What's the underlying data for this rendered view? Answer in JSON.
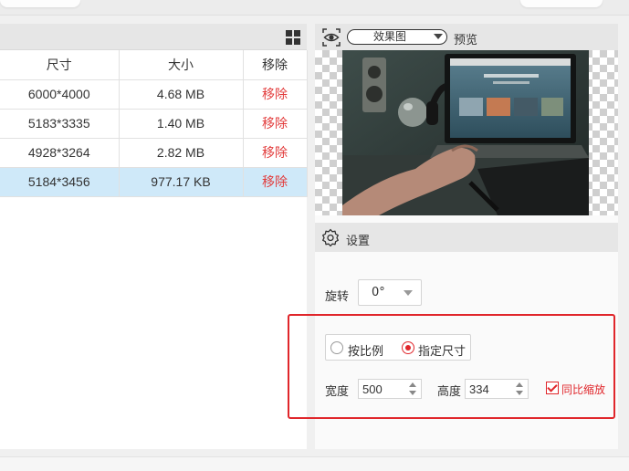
{
  "table": {
    "headers": [
      "尺寸",
      "大小",
      "移除"
    ],
    "rows": [
      {
        "size": "6000*4000",
        "filesize": "4.68 MB",
        "remove": "移除"
      },
      {
        "size": "5183*3335",
        "filesize": "1.40 MB",
        "remove": "移除"
      },
      {
        "size": "4928*3264",
        "filesize": "2.82 MB",
        "remove": "移除"
      },
      {
        "size": "5184*3456",
        "filesize": "977.17 KB",
        "remove": "移除"
      }
    ],
    "selected_row": 3
  },
  "preview": {
    "mode_select": "效果图",
    "label": "预览"
  },
  "settings": {
    "title": "设置",
    "rotate_label": "旋转",
    "rotate_value": "0°",
    "mode_ratio": "按比例",
    "mode_size": "指定尺寸",
    "selected_mode": "size",
    "width_label": "宽度",
    "width_value": "500",
    "height_label": "高度",
    "height_value": "334",
    "keep_ratio_label": "同比缩放",
    "keep_ratio_checked": true
  },
  "colors": {
    "accent": "#e0262b",
    "selected_row": "#cfe9f9",
    "header_bg": "#e6e6e6"
  },
  "icons": [
    "grid-view-icon",
    "eye-icon",
    "gear-icon"
  ]
}
